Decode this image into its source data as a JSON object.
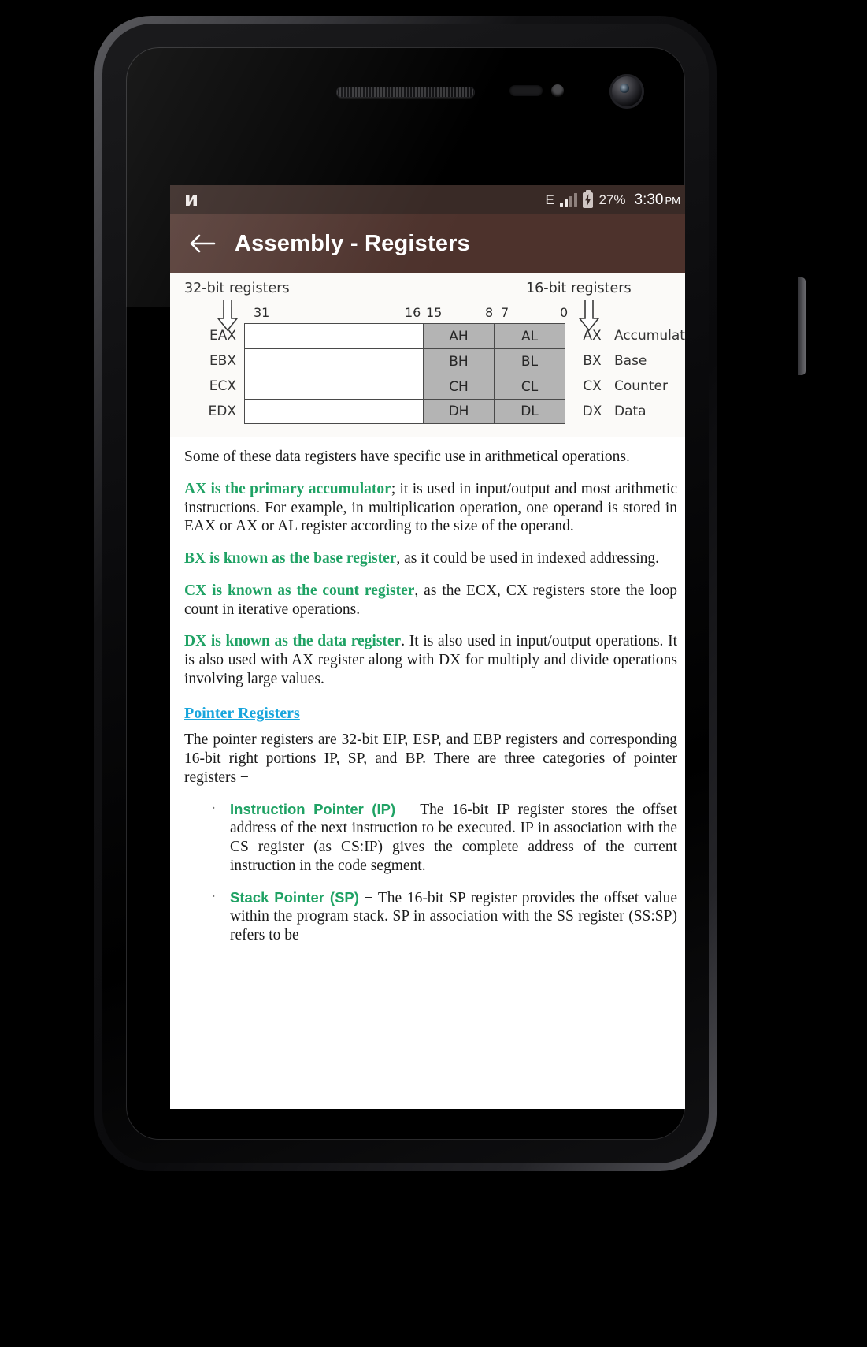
{
  "statusbar": {
    "logo_icon": "android-n-logo",
    "network_type": "E",
    "signal_icon": "signal-bars-2-of-4",
    "battery_icon": "battery-charging",
    "battery_percent": "27%",
    "time": "3:30",
    "ampm": "PM"
  },
  "appbar": {
    "back_icon": "arrow-left-icon",
    "title": "Assembly - Registers",
    "bg_color": "#4d322c"
  },
  "diagram": {
    "left_label": "32-bit registers",
    "right_label": "16-bit registers",
    "bit_labels": [
      "31",
      "16",
      "15",
      "8",
      "7",
      "0"
    ],
    "rows": [
      {
        "name32": "EAX",
        "high": "AH",
        "low": "AL",
        "name16": "AX",
        "desc": "Accumulator"
      },
      {
        "name32": "EBX",
        "high": "BH",
        "low": "BL",
        "name16": "BX",
        "desc": "Base"
      },
      {
        "name32": "ECX",
        "high": "CH",
        "low": "CL",
        "name16": "CX",
        "desc": "Counter"
      },
      {
        "name32": "EDX",
        "high": "DH",
        "low": "DL",
        "name16": "DX",
        "desc": "Data"
      }
    ]
  },
  "article": {
    "intro": "Some of these data registers have specific use in arithmetical operations.",
    "p_ax_hl": "AX is the primary accumulator",
    "p_ax_rest": "; it is used in input/output and most arithmetic instructions. For example, in multiplication operation, one operand is stored in EAX or AX or AL register according to the size of the operand.",
    "p_bx_hl": "BX is known as the base register",
    "p_bx_rest": ", as it could be used in indexed addressing.",
    "p_cx_hl": "CX is known as the count register",
    "p_cx_rest": ", as the ECX, CX registers store the loop count in iterative operations.",
    "p_dx_hl": "DX is known as the data register",
    "p_dx_rest": ". It is also used in input/output operations. It is also used with AX register along with DX for multiply and divide operations involving large values.",
    "section_heading": "Pointer Registers",
    "section_intro": "The pointer registers are 32-bit EIP, ESP, and EBP registers and corresponding 16-bit right portions IP, SP, and BP. There are three categories of pointer registers −",
    "bullets": [
      {
        "term": "Instruction Pointer (IP)",
        "text": " − The 16-bit IP register stores the offset address of the next instruction to be executed. IP in association with the CS register (as CS:IP) gives the complete address of the current instruction in the code segment."
      },
      {
        "term": " Stack Pointer (SP)",
        "text": " − The 16-bit SP register provides the offset value within the program stack. SP in association with the SS register (SS:SP) refers to be"
      }
    ],
    "highlight_color": "#1fa264",
    "link_color": "#19a6dd"
  }
}
